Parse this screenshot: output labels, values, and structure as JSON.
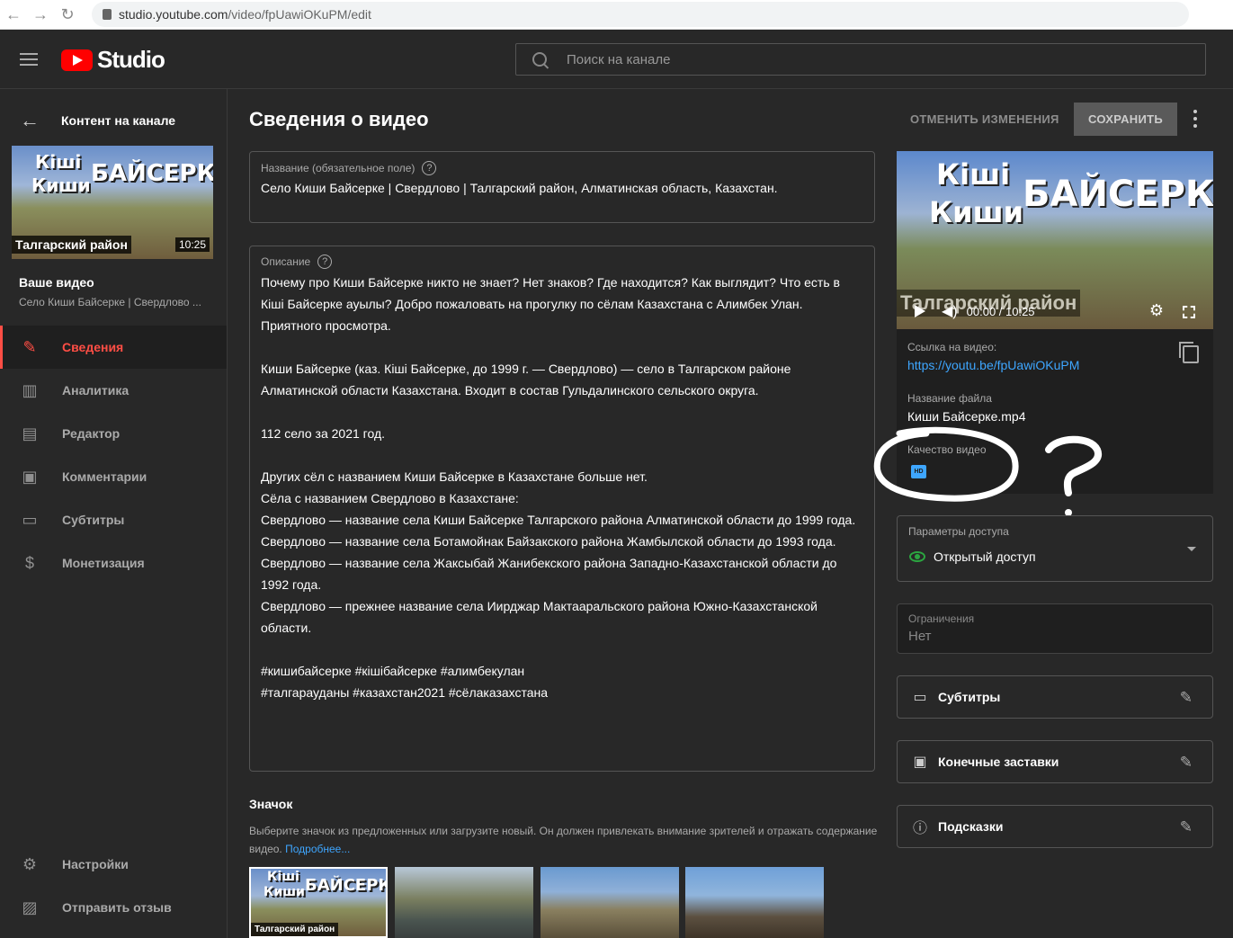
{
  "browser": {
    "url_host": "studio.youtube.com",
    "url_path": "/video/fpUawiOKuPM/edit"
  },
  "header": {
    "logo_text": "Studio",
    "search_placeholder": "Поиск на канале"
  },
  "sidebar": {
    "back_label": "Контент на канале",
    "thumb_duration": "10:25",
    "thumb_line1": "Кіші",
    "thumb_line2": "Киши",
    "thumb_line3": "БАЙСЕРКЕ",
    "thumb_badge": "Талгарский район",
    "your_video": "Ваше видео",
    "your_video_title": "Село Киши Байсерке | Свердлово ...",
    "items": [
      {
        "label": "Сведения",
        "icon": "pencil-icon",
        "active": true
      },
      {
        "label": "Аналитика",
        "icon": "analytics-icon",
        "active": false
      },
      {
        "label": "Редактор",
        "icon": "clapperboard-icon",
        "active": false
      },
      {
        "label": "Комментарии",
        "icon": "comment-icon",
        "active": false
      },
      {
        "label": "Субтитры",
        "icon": "subtitles-icon",
        "active": false
      },
      {
        "label": "Монетизация",
        "icon": "dollar-icon",
        "active": false
      }
    ],
    "bottom_items": [
      {
        "label": "Настройки",
        "icon": "gear-icon"
      },
      {
        "label": "Отправить отзыв",
        "icon": "feedback-icon"
      }
    ]
  },
  "main": {
    "page_title": "Сведения о видео",
    "undo_label": "ОТМЕНИТЬ ИЗМЕНЕНИЯ",
    "save_label": "СОХРАНИТЬ",
    "title_field": {
      "label": "Название (обязательное поле)",
      "value": "Село Киши Байсерке | Свердлово | Талгарский район, Алматинская область, Казахстан."
    },
    "description_field": {
      "label": "Описание",
      "lines": [
        "Почему про Киши Байсерке никто не знает? Нет знаков? Где находится? Как выглядит? Что есть в Кіші Байсерке ауылы? Добро пожаловать на прогулку по сёлам Казахстана с Алимбек Улан. Приятного просмотра.",
        "",
        "Киши Байсерке (каз. Кіші Байсерке, до 1999 г. — Свердлово) — село в Талгарском районе Алматинской области Казахстана. Входит в состав Гульдалинского сельского округа.",
        "",
        "112 село за 2021 год.",
        "",
        "Других сёл с названием Киши Байсерке в Казахстане больше нет.",
        "Сёла с названием Свердлово в Казахстане:",
        "Свердлово — название села Киши Байсерке Талгарского района Алматинской области до 1999 года.",
        "Свердлово — название села Ботамойнак Байзакского района Жамбылской области до 1993 года.",
        "Свердлово — название села Жаксыбай Жанибекского района Западно-Казахстанской области до 1992 года.",
        "Свердлово — прежнее название села Иирджар Мактаарaльского района Южно-Казахстанской области.",
        "",
        "#кишибайсерке #кішібайсерке #алимбекулан",
        "#талгарауданы #казахстан2021 #сёлаказахстана"
      ]
    },
    "thumbnail_section": {
      "title": "Значок",
      "desc": "Выберите значок из предложенных или загрузите новый. Он должен привлекать внимание зрителей и отражать содержание видео.",
      "more_link": "Подробнее..."
    }
  },
  "right": {
    "player_line1": "Кіші",
    "player_line2": "Киши",
    "player_line3": "БАЙСЕРКЕ",
    "player_badge": "Талгарский район",
    "time": "00:00 / 10:25",
    "link_label": "Ссылка на видео:",
    "link_value": "https://youtu.be/fpUawiOKuPM",
    "file_label": "Название файла",
    "file_value": "Киши Байсерке.mp4",
    "quality_label": "Качество видео",
    "quality_badge": "HD",
    "access_label": "Параметры доступа",
    "access_value": "Открытый доступ",
    "restrict_label": "Ограничения",
    "restrict_value": "Нет",
    "actions": [
      {
        "label": "Субтитры",
        "icon": "subtitles-icon"
      },
      {
        "label": "Конечные заставки",
        "icon": "end-screen-icon"
      },
      {
        "label": "Подсказки",
        "icon": "info-icon"
      }
    ]
  },
  "colors": {
    "accent_red": "#ff4e45",
    "link_blue": "#3ea6ff",
    "public_green": "#2ba640"
  }
}
